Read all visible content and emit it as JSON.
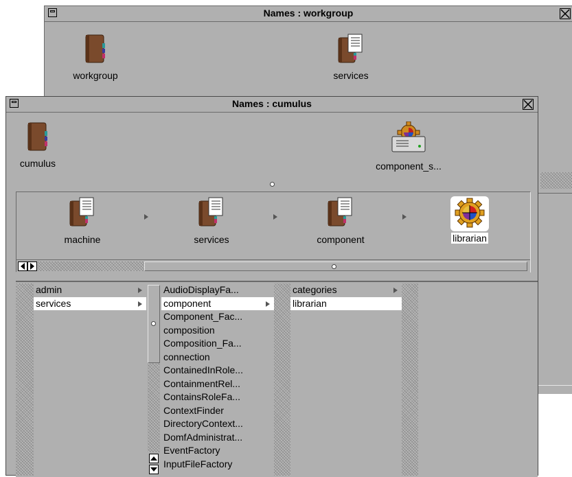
{
  "back_window": {
    "title": "Names : workgroup",
    "icons": [
      {
        "label": "workgroup",
        "icon": "closed-book-icon"
      },
      {
        "label": "services",
        "icon": "book-with-pages-icon"
      }
    ]
  },
  "front_window": {
    "title": "Names : cumulus",
    "top_icons": [
      {
        "label": "cumulus",
        "icon": "closed-book-icon"
      },
      {
        "label": "component_s...",
        "icon": "server-gear-icon"
      }
    ],
    "path_icons": [
      {
        "label": "machine",
        "icon": "book-with-pages-icon"
      },
      {
        "label": "services",
        "icon": "book-with-pages-icon"
      },
      {
        "label": "component",
        "icon": "book-with-pages-icon"
      },
      {
        "label": "librarian",
        "icon": "gear-icon"
      }
    ],
    "columns": [
      {
        "items": [
          {
            "label": "admin",
            "submenu": true
          },
          {
            "label": "services",
            "submenu": true
          }
        ]
      },
      {
        "items": [
          {
            "label": "AudioDisplayFa...",
            "submenu": false
          },
          {
            "label": "component",
            "submenu": true
          },
          {
            "label": "Component_Fac...",
            "submenu": false
          },
          {
            "label": "composition",
            "submenu": false
          },
          {
            "label": "Composition_Fa...",
            "submenu": false
          },
          {
            "label": "connection",
            "submenu": false
          },
          {
            "label": "ContainedInRole...",
            "submenu": false
          },
          {
            "label": "ContainmentRel...",
            "submenu": false
          },
          {
            "label": "ContainsRoleFa...",
            "submenu": false
          },
          {
            "label": "ContextFinder",
            "submenu": false
          },
          {
            "label": "DirectoryContext...",
            "submenu": false
          },
          {
            "label": "DomfAdministrat...",
            "submenu": false
          },
          {
            "label": "EventFactory",
            "submenu": false
          },
          {
            "label": "InputFileFactory",
            "submenu": false
          }
        ]
      },
      {
        "items": [
          {
            "label": "categories",
            "submenu": true
          },
          {
            "label": "librarian",
            "submenu": false
          }
        ]
      }
    ]
  }
}
